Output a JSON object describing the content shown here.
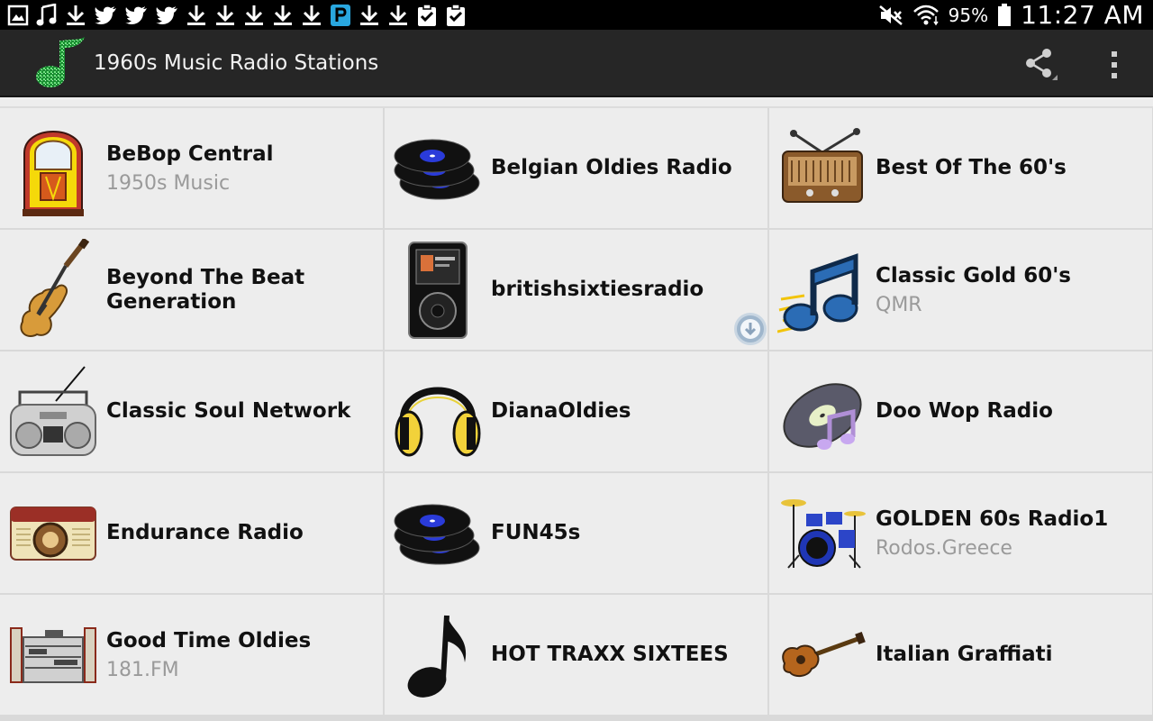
{
  "status_bar": {
    "left_icons": [
      "gallery-icon",
      "music-note-icon",
      "download-icon",
      "twitter-icon",
      "twitter-icon",
      "twitter-icon",
      "download-icon",
      "download-icon",
      "download-icon",
      "download-icon",
      "download-icon",
      "app-p-icon",
      "download-icon",
      "download-icon",
      "clipboard-check-icon",
      "clipboard-check-icon"
    ],
    "battery": "95%",
    "time": "11:27 AM"
  },
  "action_bar": {
    "title": "1960s Music Radio Stations",
    "accent": "#1ea23c"
  },
  "stations": [
    {
      "name": "BeBop Central",
      "sub": "1950s Music",
      "icon": "jukebox-icon"
    },
    {
      "name": "Belgian Oldies Radio",
      "sub": "",
      "icon": "vinyl-records-icon"
    },
    {
      "name": "Best Of The 60's",
      "sub": "",
      "icon": "vintage-radio-icon"
    },
    {
      "name": "Beyond The Beat Generation",
      "sub": "",
      "icon": "electric-guitar-icon"
    },
    {
      "name": "britishsixtiesradio",
      "sub": "",
      "icon": "ipod-icon"
    },
    {
      "name": "Classic Gold 60's",
      "sub": "QMR",
      "icon": "music-notes-icon"
    },
    {
      "name": "Classic Soul Network",
      "sub": "",
      "icon": "boombox-icon"
    },
    {
      "name": "DianaOldies",
      "sub": "",
      "icon": "headphones-icon"
    },
    {
      "name": "Doo Wop Radio",
      "sub": "",
      "icon": "vinyl-note-icon"
    },
    {
      "name": "Endurance Radio",
      "sub": "",
      "icon": "retro-radio-icon"
    },
    {
      "name": "FUN45s",
      "sub": "",
      "icon": "vinyl-records-icon"
    },
    {
      "name": "GOLDEN 60s Radio1",
      "sub": "Rodos.Greece",
      "icon": "drum-kit-icon"
    },
    {
      "name": "Good Time Oldies",
      "sub": "181.FM",
      "icon": "stereo-system-icon"
    },
    {
      "name": "HOT TRAXX SIXTEES",
      "sub": "",
      "icon": "eighth-note-icon"
    },
    {
      "name": "Italian Graffiati",
      "sub": "",
      "icon": "acoustic-guitar-icon"
    }
  ]
}
